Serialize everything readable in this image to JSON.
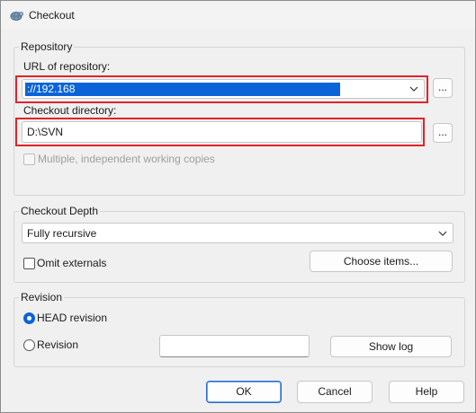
{
  "window": {
    "title": "Checkout"
  },
  "repository": {
    "group_label": "Repository",
    "url_label": "URL of repository:",
    "url_value": "://192.168",
    "url_browse": "...",
    "dir_label": "Checkout directory:",
    "dir_value": "D:\\SVN",
    "dir_browse": "...",
    "multi_label": "Multiple, independent working copies"
  },
  "depth": {
    "group_label": "Checkout Depth",
    "selected": "Fully recursive",
    "omit_label": "Omit externals",
    "choose_items": "Choose items..."
  },
  "revision": {
    "group_label": "Revision",
    "head_label": "HEAD revision",
    "rev_label": "Revision",
    "rev_value": "",
    "show_log": "Show log"
  },
  "footer": {
    "ok": "OK",
    "cancel": "Cancel",
    "help": "Help"
  },
  "colors": {
    "accent": "#0a64d8",
    "highlight_border": "#e1232a"
  }
}
